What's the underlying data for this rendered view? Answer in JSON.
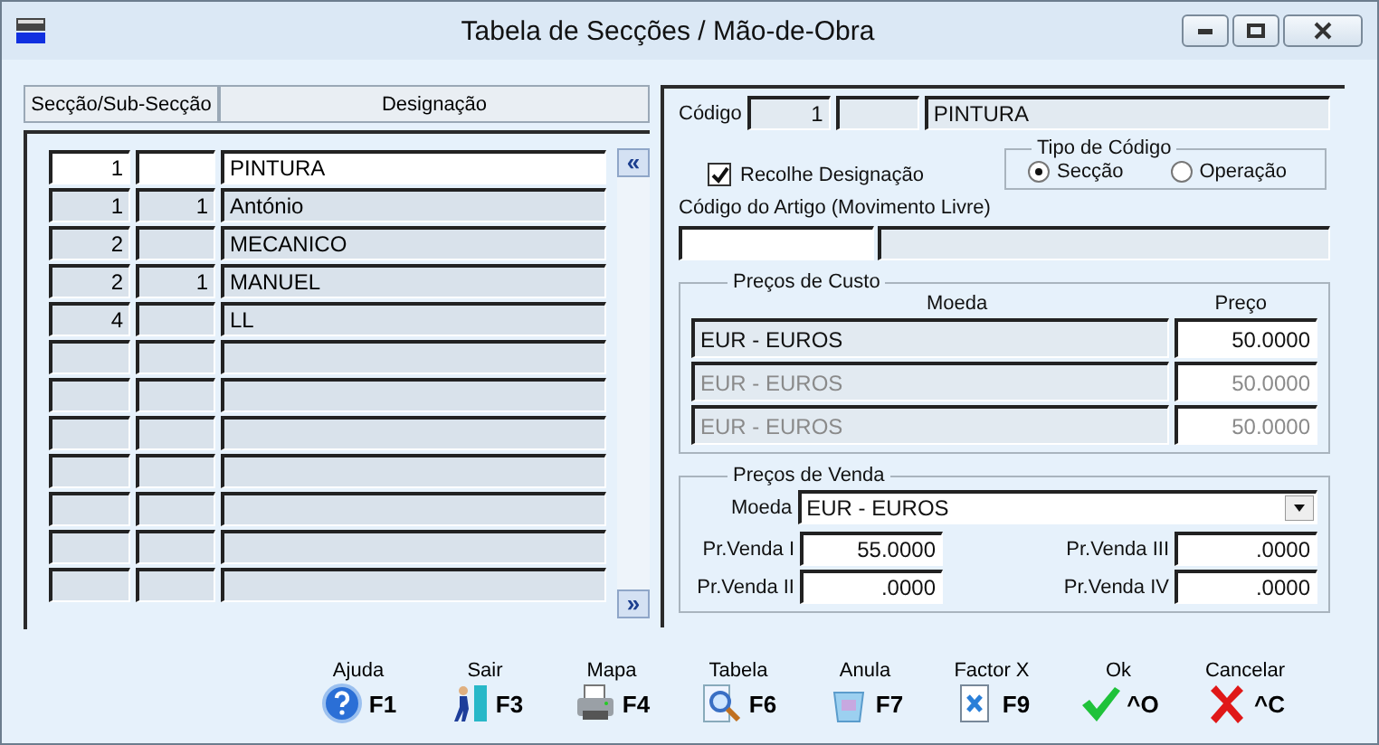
{
  "window": {
    "title": "Tabela de Secções / Mão-de-Obra"
  },
  "table": {
    "columns": [
      "Secção/Sub-Secção",
      "Designação"
    ],
    "rows": [
      {
        "seccao": "1",
        "designacao": "PINTURA",
        "selected": true
      },
      {
        "seccao": "1",
        "sub_seccao": "1",
        "designacao": "António",
        "selected": false
      },
      {
        "seccao": "2",
        "designacao": "MECANICO",
        "selected": false
      },
      {
        "seccao": "2",
        "sub_seccao": "1",
        "designacao": "MANUEL",
        "selected": false
      },
      {
        "seccao": "4",
        "designacao": "LL",
        "selected": false
      }
    ],
    "scroll_up": "«",
    "scroll_down": "»"
  },
  "form": {
    "codigo_label": "Código",
    "codigo": "1",
    "codigo_designacao": "PINTURA",
    "recolhe": {
      "label": "Recolhe Designação",
      "checked": true
    },
    "tipo": {
      "title": "Tipo de Código",
      "options": [
        {
          "label": "Secção",
          "selected": true
        },
        {
          "label": "Operação",
          "selected": false
        }
      ]
    },
    "artigo_label": "Código do Artigo (Movimento Livre)",
    "custo": {
      "title": "Preços de Custo",
      "moeda_header": "Moeda",
      "preco_header": "Preço",
      "rows": [
        {
          "moeda": "EUR - EUROS",
          "preco": "50.0000",
          "disabled": false
        },
        {
          "moeda": "EUR - EUROS",
          "preco": "50.0000",
          "disabled": true
        },
        {
          "moeda": "EUR - EUROS",
          "preco": "50.0000",
          "disabled": true
        }
      ]
    },
    "venda": {
      "title": "Preços de Venda",
      "moeda_label": "Moeda",
      "moeda": "EUR - EUROS",
      "prices": [
        {
          "label": "Pr.Venda I",
          "value": "55.0000"
        },
        {
          "label": "Pr.Venda III",
          "value": ".0000"
        },
        {
          "label": "Pr.Venda II",
          "value": ".0000"
        },
        {
          "label": "Pr.Venda IV",
          "value": ".0000"
        }
      ]
    }
  },
  "toolbar": [
    {
      "kind": "help",
      "label": "Ajuda",
      "key": "F1"
    },
    {
      "kind": "exit",
      "label": "Sair",
      "key": "F3"
    },
    {
      "kind": "print",
      "label": "Mapa",
      "key": "F4"
    },
    {
      "kind": "table",
      "label": "Tabela",
      "key": "F6"
    },
    {
      "kind": "cancel",
      "label": "Anula",
      "key": "F7"
    },
    {
      "kind": "factor",
      "label": "Factor X",
      "key": "F9"
    },
    {
      "kind": "ok",
      "label": "Ok",
      "key": "^O"
    },
    {
      "kind": "close",
      "label": "Cancelar",
      "key": "^C"
    }
  ]
}
